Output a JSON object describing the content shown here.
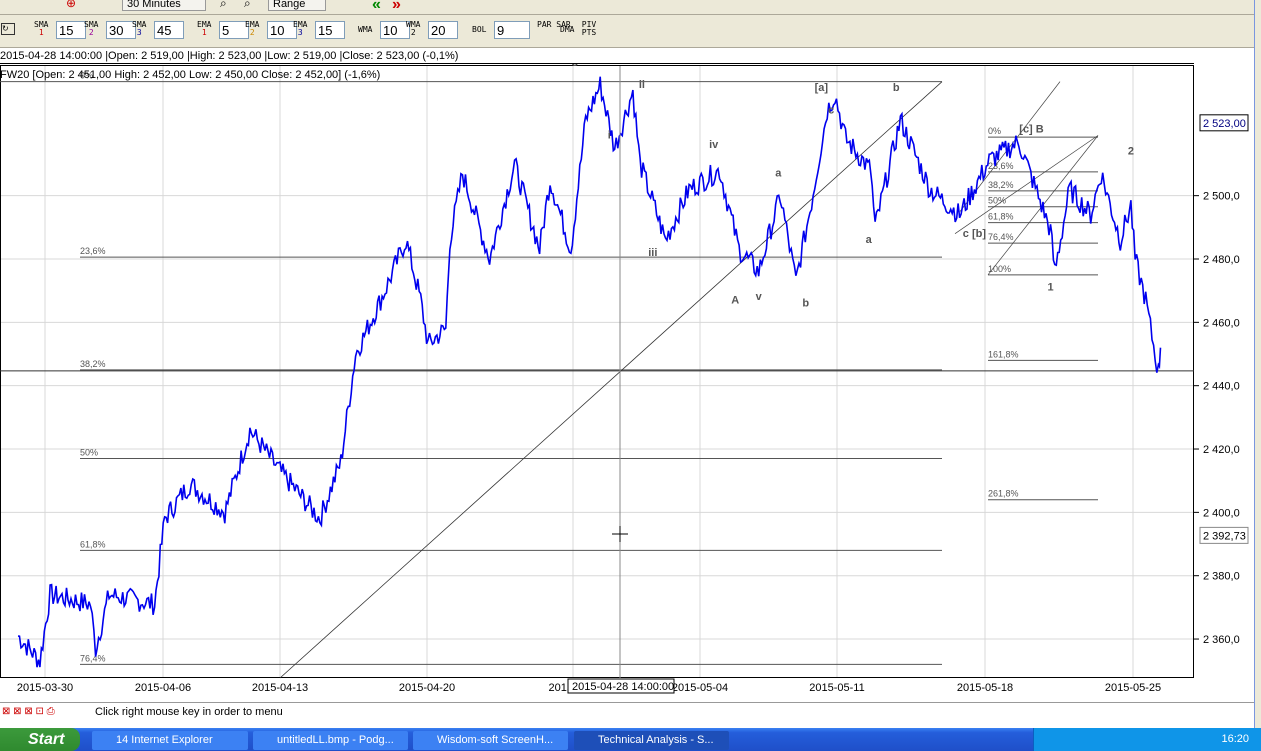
{
  "toolbar": {
    "interval": "30 Minutes",
    "range": "Range",
    "indicators": [
      {
        "name": "SMA",
        "n": "1",
        "value": "15",
        "color": "#cc0000"
      },
      {
        "name": "SMA",
        "n": "2",
        "value": "30",
        "color": "#990099"
      },
      {
        "name": "SMA",
        "n": "3",
        "value": "45",
        "color": "#000099"
      },
      {
        "name": "EMA",
        "n": "1",
        "value": "5",
        "color": "#cc0000"
      },
      {
        "name": "EMA",
        "n": "2",
        "value": "10",
        "color": "#cc8800"
      },
      {
        "name": "EMA",
        "n": "3",
        "value": "15",
        "color": "#000099"
      },
      {
        "name": "WMA",
        "n": "",
        "value": "10",
        "color": "#000"
      },
      {
        "name": "WMA",
        "n": "2",
        "value": "20",
        "color": "#000"
      },
      {
        "name": "BOL",
        "n": "",
        "value": "9",
        "color": "#000"
      }
    ],
    "par_sar": "PAR SAR",
    "dma": "DMA",
    "piv_pts": "PIV PTS"
  },
  "info": {
    "bar_line": "2015-04-28 14:00:00 |Open: 2 519,00 |High: 2 523,00 |Low: 2 519,00 |Close: 2 523,00 (-0,1%)",
    "symbol_line": "FW20 [Open: 2 451,00  High: 2 452,00  Low: 2 450,00  Close: 2 452,00] (-1,6%)"
  },
  "chart_data": {
    "type": "line",
    "title": "FW20",
    "ylim": [
      2348,
      2546
    ],
    "y_ticks": [
      {
        "v": 2360,
        "label": "2 360,0"
      },
      {
        "v": 2380,
        "label": "2 380,0"
      },
      {
        "v": 2400,
        "label": "2 400,0"
      },
      {
        "v": 2420,
        "label": "2 420,0"
      },
      {
        "v": 2440,
        "label": "2 440,0"
      },
      {
        "v": 2460,
        "label": "2 460,0"
      },
      {
        "v": 2480,
        "label": "2 480,0"
      },
      {
        "v": 2500,
        "label": "2 500,0"
      }
    ],
    "x_ticks": [
      {
        "d": 0,
        "label": "2015-03-30"
      },
      {
        "d": 7,
        "label": "2015-04-06"
      },
      {
        "d": 14,
        "label": "2015-04-13"
      },
      {
        "d": 21,
        "label": "2015-04-20"
      },
      {
        "d": 28,
        "label": "2015"
      },
      {
        "d": 35,
        "label": "2015-05-04"
      },
      {
        "d": 42,
        "label": "2015-05-11"
      },
      {
        "d": 49,
        "label": "2015-05-18"
      },
      {
        "d": 56,
        "label": "2015-05-25"
      }
    ],
    "series": [
      {
        "name": "FW20",
        "color": "#0000ee",
        "points": [
          [
            -1.6,
            2361
          ],
          [
            -0.3,
            2353
          ],
          [
            0.3,
            2374
          ],
          [
            2.7,
            2371
          ],
          [
            3.0,
            2357
          ],
          [
            3.8,
            2374
          ],
          [
            6.5,
            2371
          ],
          [
            7.1,
            2398
          ],
          [
            8.6,
            2409
          ],
          [
            10.7,
            2400
          ],
          [
            12.2,
            2426
          ],
          [
            14,
            2413
          ],
          [
            15.9,
            2398
          ],
          [
            16.9,
            2416
          ],
          [
            17.6,
            2450
          ],
          [
            19.0,
            2470
          ],
          [
            20.0,
            2486
          ],
          [
            20.7,
            2467
          ],
          [
            21.05,
            2453
          ],
          [
            21.9,
            2458
          ],
          [
            22.1,
            2486
          ],
          [
            22.7,
            2507
          ],
          [
            24.0,
            2480
          ],
          [
            25.2,
            2510
          ],
          [
            26.4,
            2483
          ],
          [
            26.9,
            2505
          ],
          [
            27.9,
            2483
          ],
          [
            28.7,
            2524
          ],
          [
            29.5,
            2535
          ],
          [
            30.3,
            2515
          ],
          [
            31.3,
            2533
          ],
          [
            31.7,
            2510
          ],
          [
            33.1,
            2486
          ],
          [
            34.4,
            2502
          ],
          [
            36.0,
            2508
          ],
          [
            37.0,
            2483
          ],
          [
            38.0,
            2476
          ],
          [
            39.1,
            2500
          ],
          [
            39.9,
            2473
          ],
          [
            40.7,
            2498
          ],
          [
            41.5,
            2527
          ],
          [
            41.9,
            2532
          ],
          [
            42.4,
            2518
          ],
          [
            43.6,
            2508
          ],
          [
            43.8,
            2490
          ],
          [
            45.0,
            2524
          ],
          [
            46.4,
            2502
          ],
          [
            47.8,
            2494
          ],
          [
            49.2,
            2511
          ],
          [
            50.6,
            2517
          ],
          [
            52.1,
            2489
          ],
          [
            52.3,
            2476
          ],
          [
            53.0,
            2502
          ],
          [
            54.0,
            2494
          ],
          [
            54.5,
            2507
          ],
          [
            55.4,
            2486
          ],
          [
            55.9,
            2497
          ],
          [
            56.1,
            2480
          ],
          [
            56.6,
            2467
          ],
          [
            57.2,
            2444
          ],
          [
            57.3,
            2452
          ]
        ]
      }
    ],
    "fib_left": [
      {
        "label": "0%",
        "v": 2536
      },
      {
        "label": "23,6%",
        "v": 2480.6
      },
      {
        "label": "38,2%",
        "v": 2445
      },
      {
        "label": "50%",
        "v": 2417
      },
      {
        "label": "61,8%",
        "v": 2388
      },
      {
        "label": "76,4%",
        "v": 2352
      }
    ],
    "fib_right": [
      {
        "label": "0%",
        "v": 2518.5
      },
      {
        "label": "23,6%",
        "v": 2507.5
      },
      {
        "label": "38,2%",
        "v": 2501.5
      },
      {
        "label": "50%",
        "v": 2496.5
      },
      {
        "label": "61,8%",
        "v": 2491.5
      },
      {
        "label": "76,4%",
        "v": 2485
      },
      {
        "label": "100%",
        "v": 2475
      },
      {
        "label": "161,8%",
        "v": 2448
      },
      {
        "label": "261,8%",
        "v": 2404
      }
    ],
    "wave_labels": [
      {
        "t": "3",
        "d": 28.1,
        "v": 2541
      },
      {
        "t": "i",
        "d": 30.0,
        "v": 2518
      },
      {
        "t": "ii",
        "d": 31.8,
        "v": 2534
      },
      {
        "t": "iii",
        "d": 32.4,
        "v": 2481
      },
      {
        "t": "iv",
        "d": 35.7,
        "v": 2515
      },
      {
        "t": "A",
        "d": 36.8,
        "v": 2466
      },
      {
        "t": "v",
        "d": 38.0,
        "v": 2467
      },
      {
        "t": "a",
        "d": 39.0,
        "v": 2506
      },
      {
        "t": "b",
        "d": 40.4,
        "v": 2465
      },
      {
        "t": "[a]",
        "d": 41.2,
        "v": 2533
      },
      {
        "t": "c",
        "d": 41.7,
        "v": 2526
      },
      {
        "t": "b",
        "d": 44.8,
        "v": 2533
      },
      {
        "t": "a",
        "d": 43.5,
        "v": 2485
      },
      {
        "t": "c [b]",
        "d": 48.5,
        "v": 2487
      },
      {
        "t": "[c] B",
        "d": 51.2,
        "v": 2520
      },
      {
        "t": "2",
        "d": 55.9,
        "v": 2513
      },
      {
        "t": "1",
        "d": 52.1,
        "v": 2470
      }
    ],
    "last_price": "2 523,00",
    "cursor_price": "2 392,73",
    "cursor_date": "2015-04-28 14:00:00"
  },
  "status": {
    "hint": "Click right mouse key in order to menu"
  },
  "taskbar": {
    "start": "Start",
    "tasks": [
      "14 Internet Explorer",
      "untitledLL.bmp - Podg...",
      "Wisdom-soft ScreenH...",
      "Technical Analysis - S..."
    ],
    "clock": "16:20"
  }
}
